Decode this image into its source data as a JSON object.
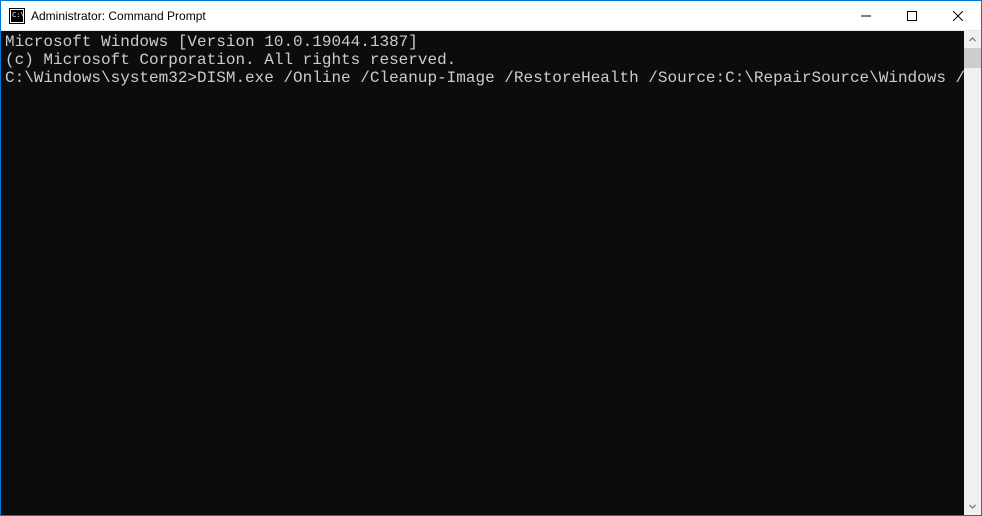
{
  "window": {
    "title": "Administrator: Command Prompt"
  },
  "terminal": {
    "line1": "Microsoft Windows [Version 10.0.19044.1387]",
    "line2": "(c) Microsoft Corporation. All rights reserved.",
    "blank": "",
    "prompt": "C:\\Windows\\system32>",
    "command": "DISM.exe /Online /Cleanup-Image /RestoreHealth /Source:C:\\RepairSource\\Windows /LimitAccess"
  }
}
